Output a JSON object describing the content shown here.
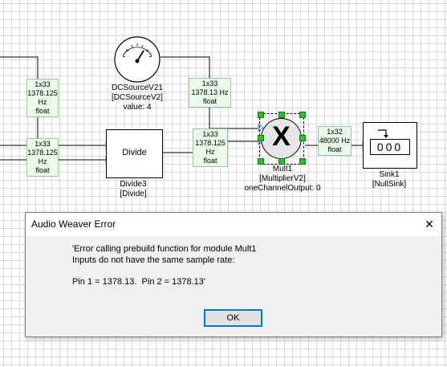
{
  "canvas": {
    "dcsource": {
      "name": "DCSourceV21",
      "type": "[DCSourceV2]",
      "value": "value: 4"
    },
    "divide": {
      "title": "Divide",
      "name": "Divide3",
      "type": "[Divide]"
    },
    "mult": {
      "glyph": "X",
      "name": "Mult1",
      "type": "[MultiplierV2]",
      "param": "oneChannelOutput: 0"
    },
    "sink": {
      "digits": "000",
      "name": "Sink1",
      "type": "[NullSink]"
    },
    "wire_info": {
      "top_left": [
        "1x33",
        "1378.125",
        "Hz",
        "float"
      ],
      "mid_left": [
        "1x33",
        "1378.125",
        "Hz",
        "float"
      ],
      "dc_out": [
        "1x33",
        "1378.13 Hz",
        "float"
      ],
      "divide_out": [
        "1x33",
        "1378.125",
        "Hz",
        "float"
      ],
      "mult_out": [
        "1x32",
        "48000 Hz",
        "float"
      ]
    }
  },
  "dialog": {
    "title": "Audio Weaver Error",
    "close_glyph": "✕",
    "line1": "'Error calling prebuild function for module Mult1",
    "line2": "Inputs do not have the same sample rate:",
    "line3": "Pin 1 = 1378.13.  Pin 2 = 1378.13'",
    "ok_label": "OK"
  },
  "colors": {
    "info_bg": "#eafbea",
    "handle": "#27c227",
    "port": "#3a7bd5",
    "ok_border": "#0078d7"
  }
}
